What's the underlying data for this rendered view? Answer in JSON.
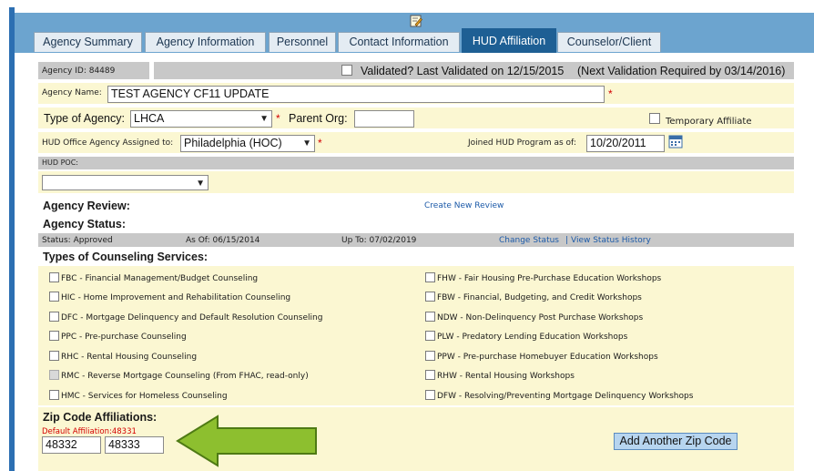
{
  "tabs": [
    {
      "label": "Agency Summary"
    },
    {
      "label": "Agency Information"
    },
    {
      "label": "Personnel"
    },
    {
      "label": "Contact Information"
    },
    {
      "label": "HUD Affiliation"
    },
    {
      "label": "Counselor/Client"
    }
  ],
  "agency_id": {
    "label": "Agency ID: 84489"
  },
  "validated": {
    "label": "Validated? Last Validated on 12/15/2015",
    "next": "(Next Validation Required by 03/14/2016)"
  },
  "agency_name": {
    "label": "Agency Name:",
    "value": "TEST AGENCY CF11 UPDATE"
  },
  "type_of_agency": {
    "label": "Type of Agency:",
    "value": "LHCA"
  },
  "parent_org": {
    "label": "Parent Org:",
    "value": ""
  },
  "temporary_affiliate": {
    "label": "Temporary Affiliate"
  },
  "hud_office": {
    "label": "HUD Office Agency Assigned to:",
    "value": "Philadelphia (HOC)"
  },
  "joined": {
    "label": "Joined HUD Program as of:",
    "value": "10/20/2011"
  },
  "hud_poc": {
    "label": "HUD POC:",
    "value": ""
  },
  "required_mark": "*",
  "agency_review": {
    "label": "Agency Review:",
    "link": "Create New Review"
  },
  "agency_status": {
    "label": "Agency Status:",
    "status": "Status: Approved",
    "as_of": "As Of: 06/15/2014",
    "up_to": "Up To: 07/02/2019",
    "change_link": "Change Status",
    "separator": "|",
    "history_link": "View Status History"
  },
  "services": {
    "label": "Types of Counseling Services:",
    "left": [
      {
        "label": "FBC - Financial Management/Budget Counseling",
        "disabled": false
      },
      {
        "label": "HIC - Home Improvement and Rehabilitation Counseling",
        "disabled": false
      },
      {
        "label": "DFC - Mortgage Delinquency and Default Resolution Counseling",
        "disabled": false
      },
      {
        "label": "PPC - Pre-purchase Counseling",
        "disabled": false
      },
      {
        "label": "RHC - Rental Housing Counseling",
        "disabled": false
      },
      {
        "label": "RMC - Reverse Mortgage Counseling (From FHAC, read-only)",
        "disabled": true
      },
      {
        "label": "HMC - Services for Homeless Counseling",
        "disabled": false
      }
    ],
    "right": [
      {
        "label": "FHW - Fair Housing Pre-Purchase Education Workshops"
      },
      {
        "label": "FBW - Financial, Budgeting, and Credit Workshops"
      },
      {
        "label": "NDW - Non-Delinquency Post Purchase Workshops"
      },
      {
        "label": "PLW - Predatory Lending Education Workshops"
      },
      {
        "label": "PPW - Pre-purchase Homebuyer Education Workshops"
      },
      {
        "label": "RHW - Rental Housing Workshops"
      },
      {
        "label": "DFW - Resolving/Preventing Mortgage Delinquency Workshops"
      }
    ]
  },
  "zip": {
    "label": "Zip Code Affiliations:",
    "default": "Default Affiliation:48331",
    "values": [
      "48332",
      "48333"
    ],
    "add_button": "Add Another Zip Code"
  },
  "colors": {
    "accent_tab": "#1e5f94",
    "panel": "#fbf7d2",
    "required": "#d40000",
    "arrow": "#8dbf2f",
    "top_slice": "#e87722"
  }
}
